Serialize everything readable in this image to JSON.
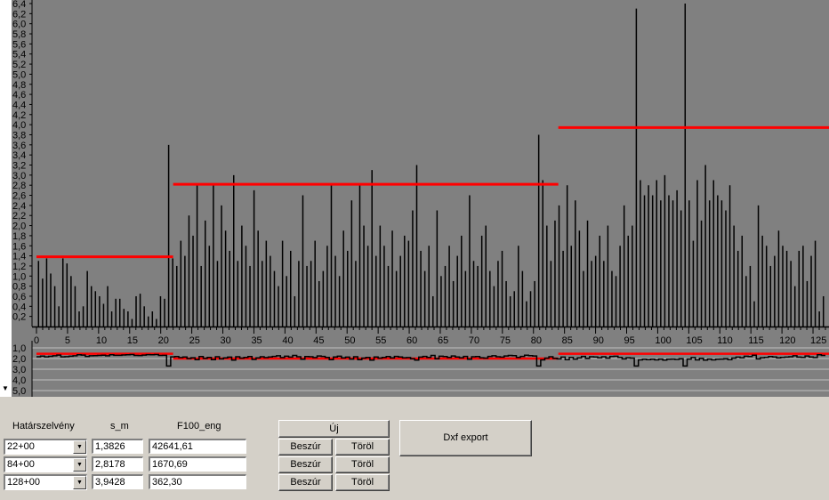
{
  "chart_data": {
    "type": "bar",
    "y_ticks": [
      "6,4",
      "6,2",
      "6,0",
      "5,8",
      "5,6",
      "5,4",
      "5,2",
      "5,0",
      "4,8",
      "4,6",
      "4,4",
      "4,2",
      "4,0",
      "3,8",
      "3,6",
      "3,4",
      "3,2",
      "3,0",
      "2,8",
      "2,6",
      "2,4",
      "2,2",
      "2,0",
      "1,8",
      "1,6",
      "1,4",
      "1,2",
      "1,0",
      "0,8",
      "0,6",
      "0,4",
      "0,2"
    ],
    "y_range": [
      0,
      6.4
    ],
    "x_ticks": [
      "0",
      "5",
      "10",
      "15",
      "20",
      "25",
      "30",
      "35",
      "40",
      "45",
      "50",
      "55",
      "60",
      "65",
      "70",
      "75",
      "80",
      "85",
      "90",
      "95",
      "100",
      "105",
      "110",
      "115",
      "120",
      "125"
    ],
    "x_range": [
      0,
      127
    ],
    "bar_values": [
      1.3,
      0.95,
      1.35,
      1.05,
      0.8,
      0.4,
      1.35,
      1.25,
      1.0,
      0.8,
      0.3,
      0.4,
      1.1,
      0.8,
      0.7,
      0.6,
      0.45,
      0.8,
      0.3,
      0.55,
      0.55,
      0.35,
      0.3,
      0.15,
      0.6,
      0.65,
      0.4,
      0.2,
      0.3,
      0.15,
      0.6,
      0.55,
      3.6,
      1.35,
      1.2,
      1.7,
      1.4,
      2.2,
      1.8,
      2.8,
      1.2,
      2.1,
      1.6,
      2.8,
      1.3,
      2.4,
      1.9,
      1.5,
      3.0,
      1.3,
      2.0,
      1.6,
      1.2,
      2.7,
      1.9,
      1.3,
      1.7,
      1.4,
      1.1,
      0.8,
      1.7,
      1.0,
      1.5,
      0.6,
      1.3,
      2.6,
      1.2,
      1.3,
      1.7,
      0.9,
      1.1,
      1.6,
      2.8,
      1.4,
      1.0,
      1.9,
      1.5,
      2.5,
      1.3,
      2.8,
      2.0,
      1.6,
      3.1,
      1.4,
      2.0,
      1.6,
      1.2,
      1.9,
      1.1,
      1.4,
      1.8,
      1.7,
      2.3,
      3.2,
      1.5,
      1.1,
      1.6,
      0.6,
      2.3,
      1.0,
      1.2,
      1.6,
      0.9,
      1.4,
      1.8,
      1.1,
      2.6,
      1.3,
      1.2,
      1.8,
      2.0,
      1.1,
      0.8,
      1.3,
      1.5,
      0.9,
      0.6,
      0.7,
      1.6,
      1.1,
      0.5,
      0.7,
      0.9,
      3.8,
      2.9,
      2.0,
      1.3,
      2.1,
      2.4,
      1.5,
      2.8,
      1.6,
      2.5,
      1.9,
      1.1,
      2.1,
      1.3,
      1.4,
      1.8,
      1.3,
      2.0,
      1.1,
      1.0,
      1.6,
      2.4,
      1.8,
      2.0,
      6.3,
      2.9,
      2.6,
      2.8,
      2.6,
      2.9,
      2.5,
      3.0,
      2.6,
      2.5,
      2.7,
      2.3,
      6.4,
      2.5,
      1.7,
      2.9,
      2.1,
      3.2,
      2.5,
      2.9,
      2.6,
      2.5,
      2.3,
      2.8,
      2.0,
      1.5,
      1.8,
      1.0,
      1.2,
      0.5,
      2.4,
      1.8,
      1.6,
      1.2,
      1.4,
      1.9,
      1.6,
      1.5,
      1.3,
      0.8,
      1.5,
      1.6,
      0.9,
      1.4,
      1.7,
      0.3,
      0.6
    ],
    "series_lines": [
      {
        "x_from": 0,
        "x_to": 22,
        "y": 1.3826
      },
      {
        "x_from": 22,
        "x_to": 84,
        "y": 2.8178
      },
      {
        "x_from": 84,
        "x_to": 128,
        "y": 3.9428
      }
    ],
    "lower_ticks": [
      "1,0",
      "2,0",
      "3,0",
      "4,0",
      "5,0"
    ],
    "colors": {
      "background": "#808080",
      "bars": "#000000",
      "lines": "#ff0000",
      "grid": "#c0c0c0"
    }
  },
  "form": {
    "header_hatar": "Határszelvény",
    "header_sm": "s_m",
    "header_f100": "F100_eng",
    "rows": [
      {
        "hatar": "22+00",
        "sm": "1,3826",
        "f100": "42641,61",
        "beszur": "Beszúr",
        "torol": "Töröl"
      },
      {
        "hatar": "84+00",
        "sm": "2,8178",
        "f100": "1670,69",
        "beszur": "Beszúr",
        "torol": "Töröl"
      },
      {
        "hatar": "128+00",
        "sm": "3,9428",
        "f100": "362,30",
        "beszur": "Beszúr",
        "torol": "Töröl"
      }
    ],
    "uj_label": "Új",
    "dxf_label": "Dxf export"
  }
}
